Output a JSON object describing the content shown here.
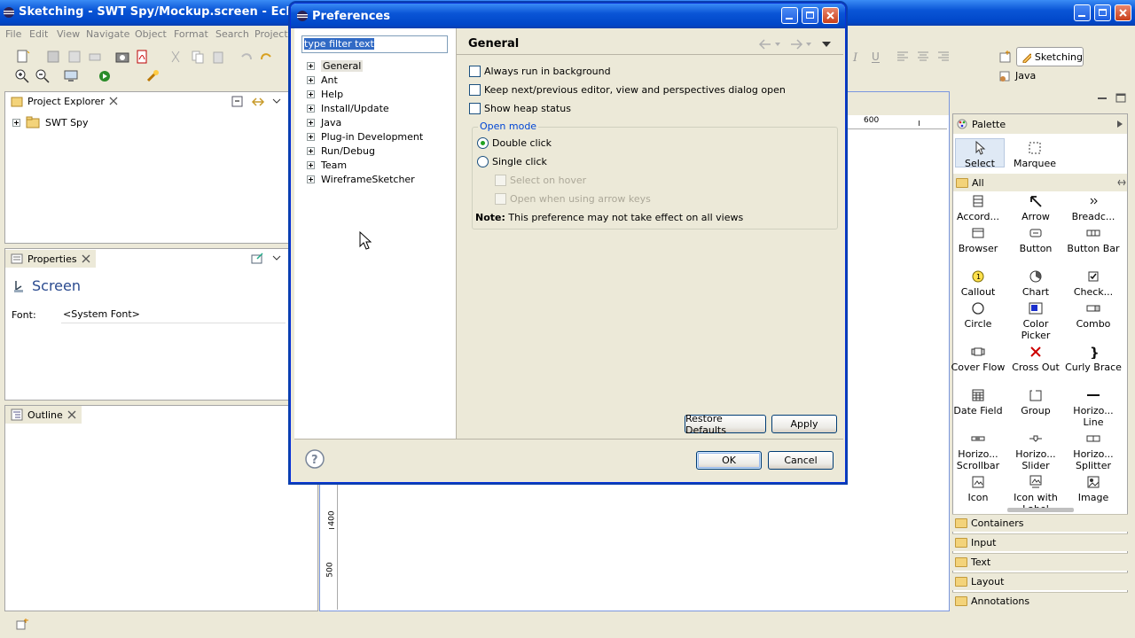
{
  "window": {
    "title": "Sketching - SWT Spy/Mockup.screen - Eclipse SDK"
  },
  "menu": [
    "File",
    "Edit",
    "View",
    "Navigate",
    "Object",
    "Format",
    "Search",
    "Project"
  ],
  "perspectives": {
    "active": "Sketching",
    "other": "Java"
  },
  "project_explorer": {
    "title": "Project Explorer",
    "items": [
      "SWT Spy"
    ]
  },
  "properties": {
    "title": "Properties",
    "heading": "Screen",
    "font_label": "Font:",
    "font_value": "<System Font>"
  },
  "outline": {
    "title": "Outline"
  },
  "ruler": {
    "top_label": "600",
    "side_labels": [
      "400",
      "500"
    ]
  },
  "palette": {
    "title": "Palette",
    "tools": [
      "Select",
      "Marquee"
    ],
    "drawer_all": "All",
    "items": [
      "Accord...",
      "Arrow",
      "Breadc...",
      "Browser",
      "Button",
      "Button Bar",
      "Callout",
      "Chart",
      "Check...",
      "Circle",
      "Color Picker",
      "Combo",
      "Cover Flow",
      "Cross Out",
      "Curly Brace",
      "Date Field",
      "Group",
      "Horizo... Line",
      "Horizo... Scrollbar",
      "Horizo... Slider",
      "Horizo... Splitter",
      "Icon",
      "Icon with Label",
      "Image"
    ],
    "drawers": [
      "Containers",
      "Input",
      "Text",
      "Layout",
      "Annotations"
    ]
  },
  "dialog": {
    "title": "Preferences",
    "filter_placeholder": "type filter text",
    "tree": [
      "General",
      "Ant",
      "Help",
      "Install/Update",
      "Java",
      "Plug-in Development",
      "Run/Debug",
      "Team",
      "WireframeSketcher"
    ],
    "page_title": "General",
    "options": {
      "always_run_background": "Always run in background",
      "keep_next_prev": "Keep next/previous editor, view and perspectives dialog open",
      "show_heap": "Show heap status"
    },
    "open_mode": {
      "title": "Open mode",
      "double_click": "Double click",
      "single_click": "Single click",
      "select_on_hover": "Select on hover",
      "open_arrow_keys": "Open when using arrow keys",
      "note_label": "Note:",
      "note_text": "This preference may not take effect on all views"
    },
    "buttons": {
      "restore": "Restore Defaults",
      "apply": "Apply",
      "ok": "OK",
      "cancel": "Cancel"
    }
  }
}
